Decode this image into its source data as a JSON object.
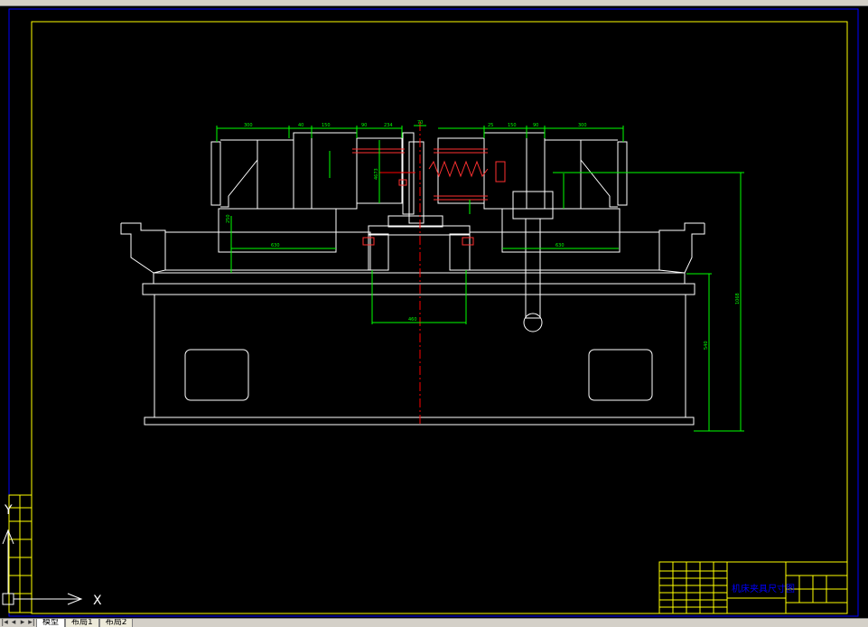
{
  "drawing": {
    "title_block_text": "机床夹具尺寸图",
    "dimensions": {
      "d_left_width": "300",
      "d_left_a": "40",
      "d_left_b": "150",
      "d_left_c": "90",
      "d_left_d": "234",
      "d_center": "70",
      "d_right_a": "25",
      "d_right_b": "150",
      "d_right_c": "90",
      "d_right_d": "300",
      "d_bottom_left": "630",
      "d_bottom_right": "630",
      "d_center_bottom": "460",
      "d_height_total": "1068",
      "d_height_base": "540",
      "d_vert_1": "250",
      "d_vert_2": "4673"
    },
    "ucs": {
      "x_label": "X",
      "y_label": "Y"
    }
  },
  "tabs": {
    "items": [
      {
        "label": "模型"
      },
      {
        "label": "布局1"
      },
      {
        "label": "布局2"
      }
    ]
  },
  "colors": {
    "background": "#000000",
    "outline": "#ffffff",
    "dimension": "#00ff00",
    "centerline": "#ff0000",
    "frame": "#ffff00",
    "border": "#0000ff",
    "title_text": "#0000ff"
  }
}
